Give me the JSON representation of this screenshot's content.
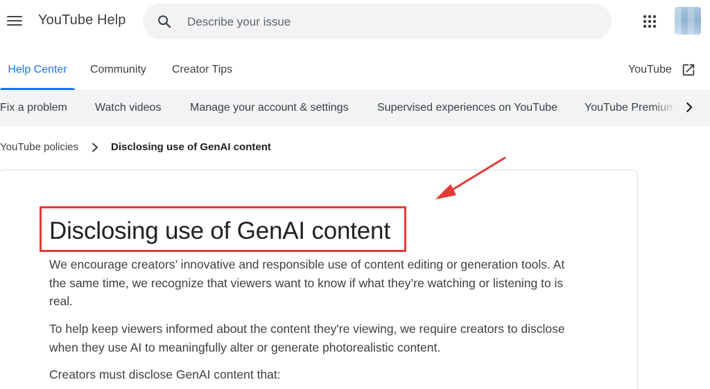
{
  "header": {
    "app_title": "YouTube Help",
    "search_placeholder": "Describe your issue",
    "icons": {
      "menu": "menu-icon",
      "search": "search-icon",
      "apps": "apps-grid-icon",
      "avatar": "avatar"
    }
  },
  "tabs": {
    "items": [
      {
        "label": "Help Center",
        "active": true
      },
      {
        "label": "Community",
        "active": false
      },
      {
        "label": "Creator Tips",
        "active": false
      }
    ],
    "external_link": {
      "label": "YouTube",
      "icon": "open-in-new-icon"
    }
  },
  "categories": {
    "items": [
      "Fix a problem",
      "Watch videos",
      "Manage your account & settings",
      "Supervised experiences on YouTube",
      "YouTube Premium"
    ],
    "next_icon": "chevron-right-icon"
  },
  "breadcrumb": {
    "parent": "YouTube policies",
    "current": "Disclosing use of GenAI content",
    "separator_icon": "chevron-right-icon"
  },
  "article": {
    "title": "Disclosing use of GenAI content",
    "paragraphs": [
      "We encourage creators’ innovative and responsible use of content editing or generation tools. At the same time, we recognize that viewers want to know if what they’re watching or listening to is real.",
      "To help keep viewers informed about the content they're viewing, we require creators to disclose when they use AI to meaningfully alter or generate photorealistic content.",
      "Creators must disclose GenAI content that:"
    ]
  },
  "annotation": {
    "highlight_color": "#e53935",
    "arrow_icon": "red-arrow-icon"
  },
  "colors": {
    "accent": "#1a73e8",
    "category_bar_bg": "#f1f3f4",
    "text_primary": "#202124"
  }
}
